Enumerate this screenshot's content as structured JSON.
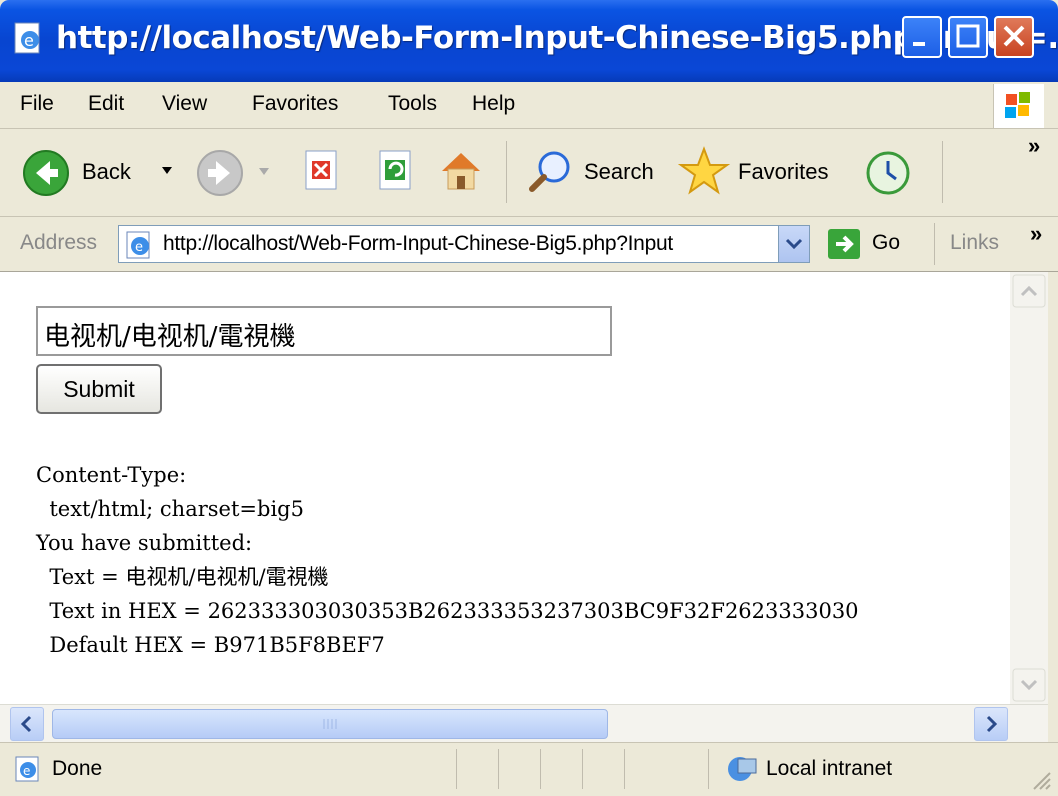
{
  "window": {
    "title": "http://localhost/Web-Form-Input-Chinese-Big5.php?Input=..."
  },
  "menu": {
    "items": [
      "File",
      "Edit",
      "View",
      "Favorites",
      "Tools",
      "Help"
    ]
  },
  "toolbar": {
    "back_label": "Back",
    "search_label": "Search",
    "favorites_label": "Favorites",
    "overflow": "»"
  },
  "address_bar": {
    "label": "Address",
    "url": "http://localhost/Web-Form-Input-Chinese-Big5.php?Input",
    "go_label": "Go",
    "links_label": "Links",
    "links_overflow": "»"
  },
  "form": {
    "input_value": "电视机/电视机/電視機",
    "submit_label": "Submit"
  },
  "output": {
    "line1": "Content-Type:",
    "line2": "  text/html; charset=big5",
    "line3": "You have submitted:",
    "line4": "  Text = 电视机/电视机/電視機",
    "line5": "  Text in HEX = 262333303030353B262333353237303BC9F32F2623333030",
    "line6": "  Default HEX = B971B5F8BEF7"
  },
  "status_bar": {
    "status": "Done",
    "zone": "Local intranet"
  },
  "colors": {
    "titlebar": "#0a54e3",
    "chrome": "#ece9d8"
  }
}
